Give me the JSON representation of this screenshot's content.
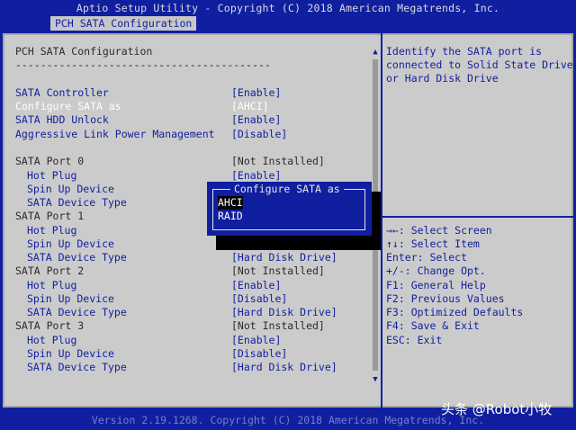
{
  "header": {
    "title": "Aptio Setup Utility - Copyright (C) 2018 American Megatrends, Inc.",
    "active_tab": "PCH SATA Configuration"
  },
  "main": {
    "section_title": "PCH SATA Configuration",
    "separator": "-----------------------------------------",
    "settings": [
      {
        "label": "SATA Controller",
        "value": "[Enable]"
      },
      {
        "label": "Configure SATA as",
        "value": "[AHCI]"
      },
      {
        "label": "SATA HDD Unlock",
        "value": "[Enable]"
      },
      {
        "label": "Aggressive Link Power Management",
        "value": "[Disable]"
      },
      {
        "label": "SATA Port 0",
        "value": "[Not Installed]"
      },
      {
        "label": "Hot Plug",
        "value": "[Enable]"
      },
      {
        "label": "Spin Up Device",
        "value": ""
      },
      {
        "label": "SATA Device Type",
        "value": ""
      },
      {
        "label": "SATA Port 1",
        "value": ""
      },
      {
        "label": "Hot Plug",
        "value": ""
      },
      {
        "label": "Spin Up Device",
        "value": ""
      },
      {
        "label": "SATA Device Type",
        "value": "[Hard Disk Drive]"
      },
      {
        "label": "SATA Port 2",
        "value": "[Not Installed]"
      },
      {
        "label": "Hot Plug",
        "value": "[Enable]"
      },
      {
        "label": "Spin Up Device",
        "value": "[Disable]"
      },
      {
        "label": "SATA Device Type",
        "value": "[Hard Disk Drive]"
      },
      {
        "label": "SATA Port 3",
        "value": "[Not Installed]"
      },
      {
        "label": "Hot Plug",
        "value": "[Enable]"
      },
      {
        "label": "Spin Up Device",
        "value": "[Disable]"
      },
      {
        "label": "SATA Device Type",
        "value": "[Hard Disk Drive]"
      }
    ]
  },
  "help": {
    "lines": [
      "Identify the SATA port is",
      "connected to Solid State Drive",
      "or Hard Disk Drive"
    ]
  },
  "keys": {
    "lines": [
      "→←: Select Screen",
      "↑↓: Select Item",
      "Enter: Select",
      "+/-: Change Opt.",
      "F1: General Help",
      "F2: Previous Values",
      "F3: Optimized Defaults",
      "F4: Save & Exit",
      "ESC: Exit"
    ]
  },
  "popup": {
    "title": "Configure SATA as",
    "options": [
      "AHCI",
      "RAID"
    ],
    "selected": "AHCI"
  },
  "footer": {
    "text": "Version 2.19.1268. Copyright (C) 2018 American Megatrends, Inc."
  },
  "watermark": {
    "text": "头条 @Robot小牧"
  },
  "colors": {
    "bios_blue": "#0f1f9f",
    "panel_gray": "#cbcbcb",
    "highlight": "#ffffff"
  }
}
